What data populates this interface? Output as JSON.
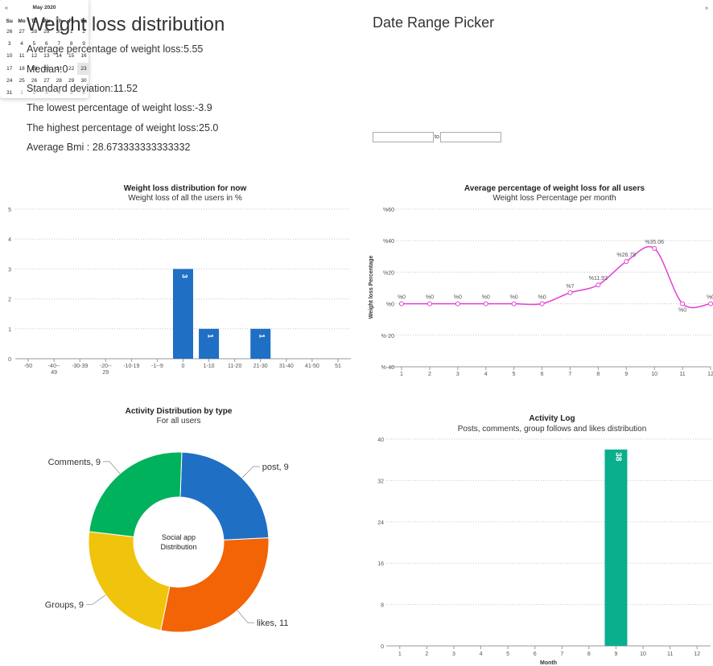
{
  "stats": {
    "title": "Weight loss distribution",
    "lines": [
      "Average percentage of weight loss:5.55",
      "Median:0",
      "Standard deviation:11.52",
      "The lowest percentage of weight loss:-3.9",
      "The highest percentage of weight loss:25.0",
      "Average Bmi : 28.673333333333332"
    ]
  },
  "date_picker": {
    "title": "Date Range Picker",
    "prev_icon": "«",
    "next_icon": "»",
    "month_label": "May 2020",
    "weekdays": [
      "Su",
      "Mo",
      "Tu",
      "We",
      "Th",
      "Fr",
      "Sa"
    ],
    "weeks": [
      [
        "26",
        "27",
        "28",
        "29",
        "30",
        "1",
        "2"
      ],
      [
        "3",
        "4",
        "5",
        "6",
        "7",
        "8",
        "9"
      ],
      [
        "10",
        "11",
        "12",
        "13",
        "14",
        "15",
        "16"
      ],
      [
        "17",
        "18",
        "19",
        "20",
        "21",
        "22",
        "23"
      ],
      [
        "24",
        "25",
        "26",
        "27",
        "28",
        "29",
        "30"
      ],
      [
        "31",
        "1",
        "2",
        "3",
        "4",
        "5",
        "6"
      ]
    ],
    "to_label": "to",
    "start_value": "",
    "end_value": ""
  },
  "chart_data": [
    {
      "type": "bar",
      "title": "Weight loss distribution for now",
      "subtitle": "Weight loss of all the users in %",
      "categories": [
        "-50",
        "-40--49",
        "-30-39",
        "-20--29",
        "-10-19",
        "-1--9",
        "0",
        "1-10",
        "11-20",
        "21-30",
        "31-40",
        "41-50",
        "51"
      ],
      "values": [
        0,
        0,
        0,
        0,
        0,
        0,
        3,
        1,
        0,
        1,
        0,
        0,
        0
      ],
      "data_labels": [
        null,
        null,
        null,
        null,
        null,
        null,
        "3",
        "1",
        null,
        "1",
        null,
        null,
        null
      ],
      "ylim": [
        0,
        5
      ],
      "yticks": [
        0,
        1,
        2,
        3,
        4,
        5
      ],
      "ytick_labels": [
        "0",
        "1",
        "2",
        "3",
        "4",
        "5"
      ],
      "color": "#1f6fc5",
      "grid": true
    },
    {
      "type": "line",
      "title": "Average percentage of weight loss for all users",
      "subtitle": "Weight loss Percentage per month",
      "ylabel": "Weight loss Percentage",
      "x": [
        "1",
        "2",
        "3",
        "4",
        "5",
        "6",
        "7",
        "8",
        "9",
        "10",
        "11",
        "12"
      ],
      "values": [
        0,
        0,
        0,
        0,
        0,
        0,
        7,
        11.92,
        26.79,
        35.06,
        0,
        0
      ],
      "data_labels": [
        "%0",
        "%0",
        "%0",
        "%0",
        "%0",
        "%0",
        "%7",
        "%11.92",
        "%26.79",
        "%35.06",
        "%0",
        "%0"
      ],
      "ylim": [
        -40,
        60
      ],
      "yticks": [
        -40,
        -20,
        0,
        20,
        40,
        60
      ],
      "ytick_labels": [
        "%-40",
        "%-20",
        "%0",
        "%20",
        "%40",
        "%60"
      ],
      "color": "#e23fd6",
      "grid": true
    },
    {
      "type": "pie",
      "title": "Activity Distribution by type",
      "subtitle": "For all users",
      "center_label": [
        "Social app",
        "Distribution"
      ],
      "slices": [
        {
          "label": "post",
          "value": 9,
          "display": "post, 9",
          "color": "#1f6fc5"
        },
        {
          "label": "likes",
          "value": 11,
          "display": "likes, 11",
          "color": "#f26405"
        },
        {
          "label": "Groups",
          "value": 9,
          "display": "Groups, 9",
          "color": "#f0c30c"
        },
        {
          "label": "Comments",
          "value": 9,
          "display": "Comments, 9",
          "color": "#00b25c"
        }
      ]
    },
    {
      "type": "bar",
      "title": "Activity Log",
      "subtitle": "Posts, comments, group follows and likes distribution",
      "xlabel": "Month",
      "categories": [
        "1",
        "2",
        "3",
        "4",
        "5",
        "6",
        "7",
        "8",
        "9",
        "10",
        "11",
        "12"
      ],
      "values": [
        0,
        0,
        0,
        0,
        0,
        0,
        0,
        0,
        38,
        0,
        0,
        0
      ],
      "data_labels": [
        null,
        null,
        null,
        null,
        null,
        null,
        null,
        null,
        "38",
        null,
        null,
        null
      ],
      "ylim": [
        0,
        40
      ],
      "yticks": [
        0,
        8,
        16,
        24,
        32,
        40
      ],
      "ytick_labels": [
        "0",
        "8",
        "16",
        "24",
        "32",
        "40"
      ],
      "color": "#0aaf8e",
      "grid": true
    }
  ]
}
